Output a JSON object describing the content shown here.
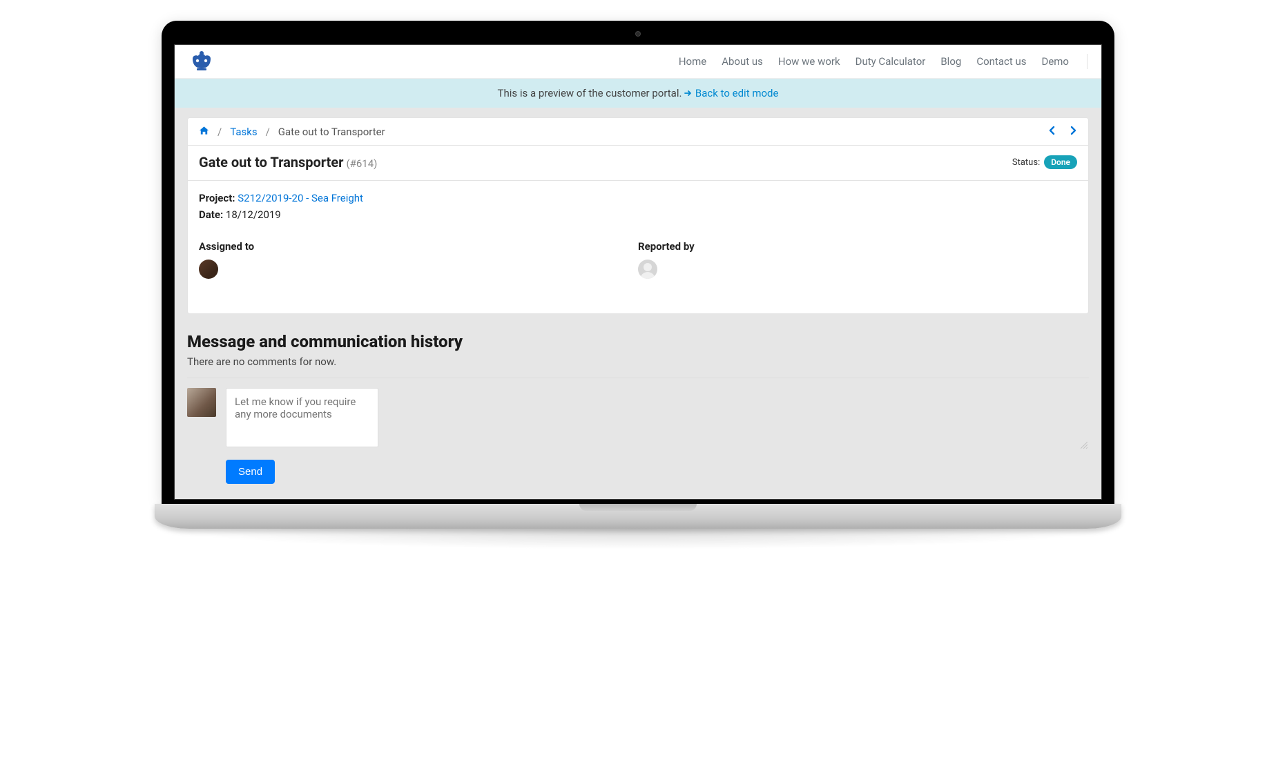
{
  "header": {
    "nav": [
      {
        "label": "Home"
      },
      {
        "label": "About us"
      },
      {
        "label": "How we work"
      },
      {
        "label": "Duty Calculator"
      },
      {
        "label": "Blog"
      },
      {
        "label": "Contact us"
      },
      {
        "label": "Demo"
      }
    ]
  },
  "preview_bar": {
    "text": "This is a preview of the customer portal.",
    "link_text": "Back to edit mode"
  },
  "breadcrumb": {
    "tasks_label": "Tasks",
    "sep": "/",
    "current": "Gate out to Transporter"
  },
  "task": {
    "title": "Gate out to Transporter",
    "id_display": "(#614)",
    "status_label": "Status:",
    "status_value": "Done",
    "project_label": "Project:",
    "project_link": "S212/2019-20 - Sea Freight",
    "date_label": "Date:",
    "date_value": "18/12/2019",
    "assigned_label": "Assigned to",
    "reported_label": "Reported by"
  },
  "history": {
    "heading": "Message and communication history",
    "empty_text": "There are no comments for now."
  },
  "compose": {
    "value": "Let me know if you require any more documents",
    "send_label": "Send"
  }
}
